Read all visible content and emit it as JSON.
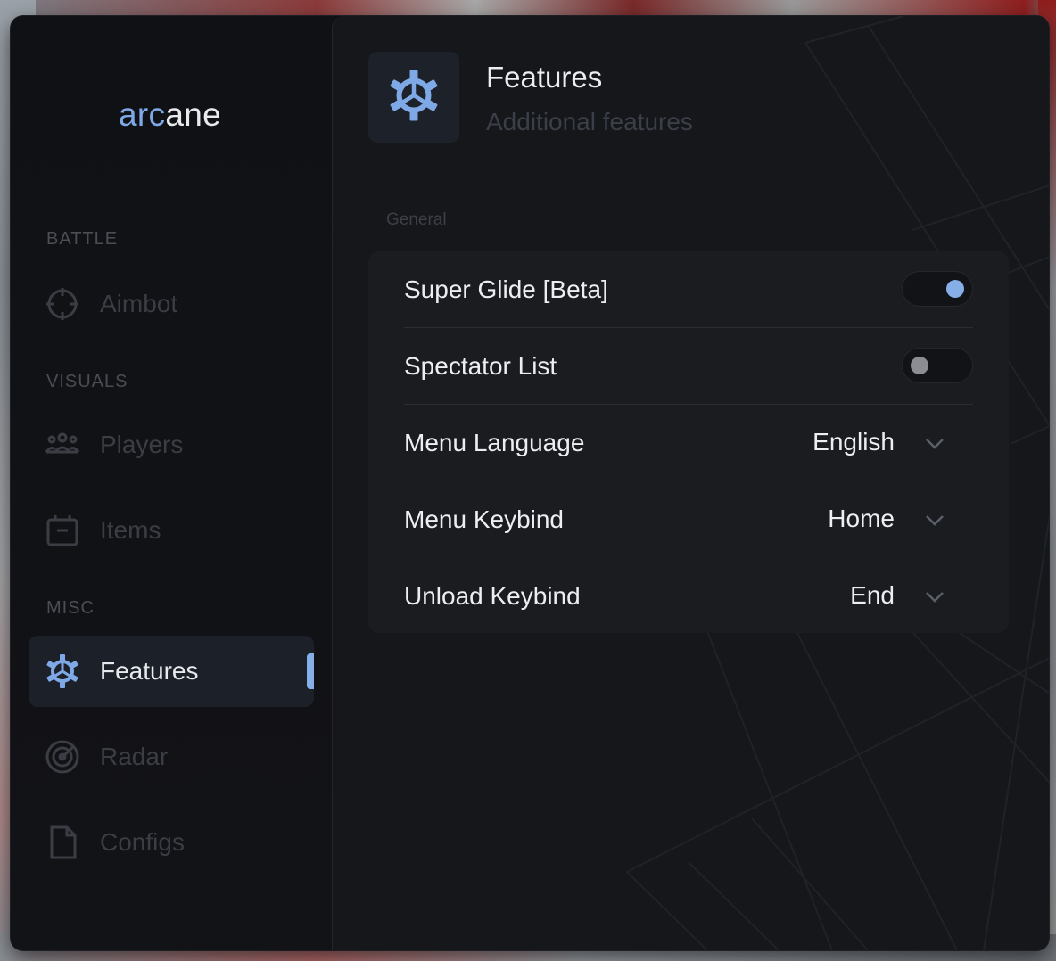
{
  "app": {
    "logo_part1": "arc",
    "logo_part2": "ane",
    "accent_color": "#86aee9"
  },
  "sidebar": {
    "sections": [
      {
        "label": "BATTLE"
      },
      {
        "label": "VISUALS"
      },
      {
        "label": "MISC"
      }
    ],
    "items": [
      {
        "label": "Aimbot",
        "icon": "crosshair-icon",
        "active": false
      },
      {
        "label": "Players",
        "icon": "players-icon",
        "active": false
      },
      {
        "label": "Items",
        "icon": "box-icon",
        "active": false
      },
      {
        "label": "Features",
        "icon": "gear-icon",
        "active": true
      },
      {
        "label": "Radar",
        "icon": "radar-icon",
        "active": false
      },
      {
        "label": "Configs",
        "icon": "file-icon",
        "active": false
      }
    ]
  },
  "header": {
    "icon": "gear-icon",
    "title": "Features",
    "subtitle": "Additional features"
  },
  "general": {
    "label": "General",
    "settings": [
      {
        "label": "Super Glide [Beta]",
        "type": "toggle",
        "state": "on"
      },
      {
        "label": "Spectator List",
        "type": "toggle",
        "state": "off"
      },
      {
        "label": "Menu Language",
        "type": "select",
        "value": "English"
      },
      {
        "label": "Menu Keybind",
        "type": "select",
        "value": "Home"
      },
      {
        "label": "Unload Keybind",
        "type": "select",
        "value": "End"
      }
    ]
  }
}
